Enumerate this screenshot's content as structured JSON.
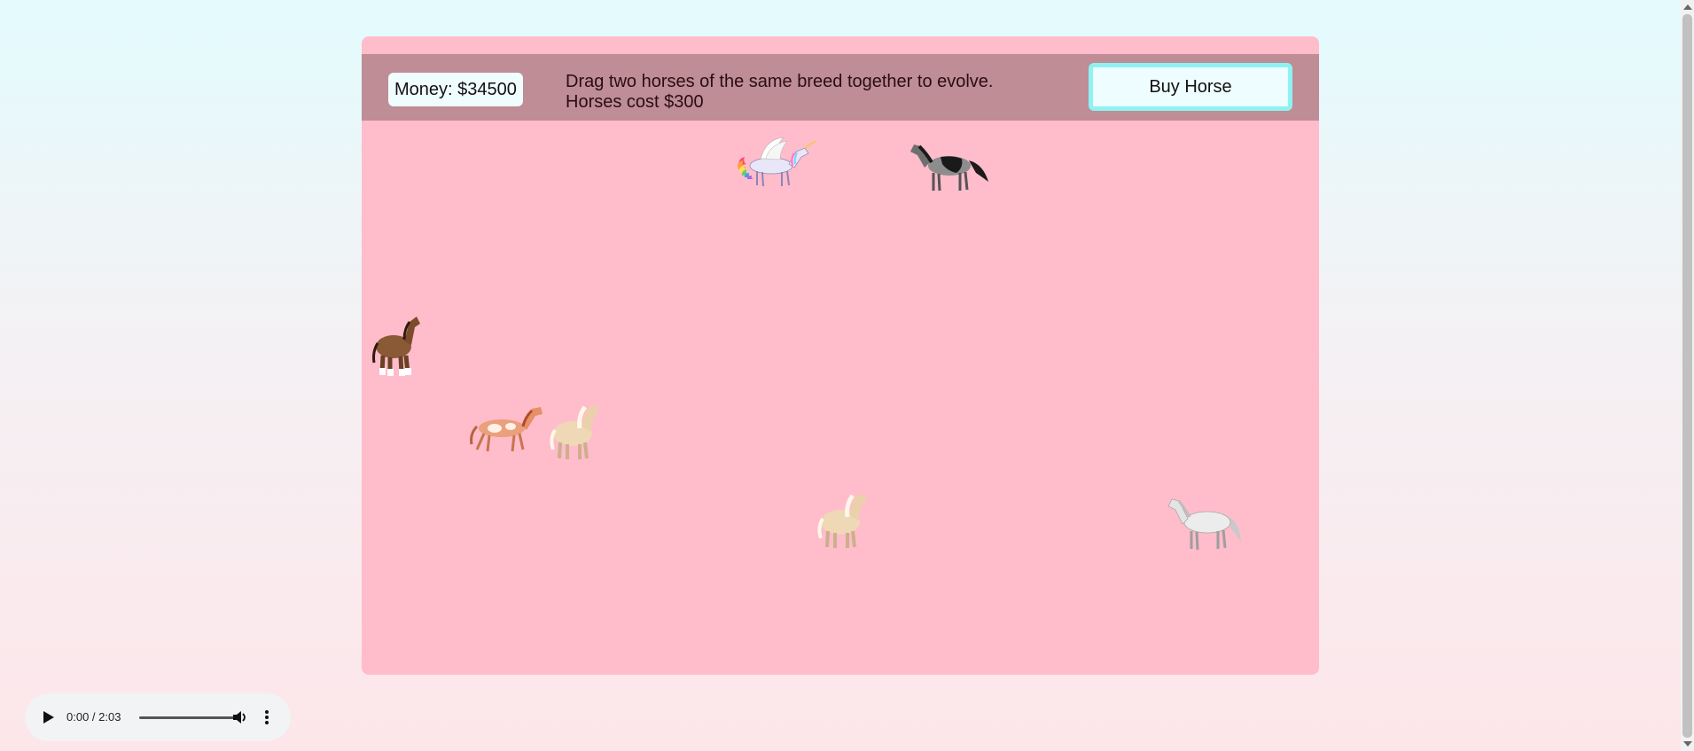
{
  "hud": {
    "money_label": "Money: $34500",
    "instruction_line1": "Drag two horses of the same breed together to evolve.",
    "instruction_line2": "Horses cost $300",
    "buy_button": "Buy Horse"
  },
  "horses": [
    {
      "name": "unicorn-pegasus-horse",
      "breed": "rainbow winged unicorn"
    },
    {
      "name": "black-grey-horse",
      "breed": "black and grey"
    },
    {
      "name": "brown-clydesdale-horse",
      "breed": "brown draft"
    },
    {
      "name": "chestnut-pinto-horse",
      "breed": "chestnut pinto"
    },
    {
      "name": "palomino-pony-1",
      "breed": "palomino pony"
    },
    {
      "name": "palomino-pony-2",
      "breed": "palomino pony"
    },
    {
      "name": "white-grey-horse",
      "breed": "white grey"
    }
  ],
  "audio": {
    "time": "0:00 / 2:03",
    "progress": 0
  },
  "colors": {
    "field": "#ffbccb",
    "topbar": "#be8d95",
    "button_border": "#8ff2f2"
  }
}
